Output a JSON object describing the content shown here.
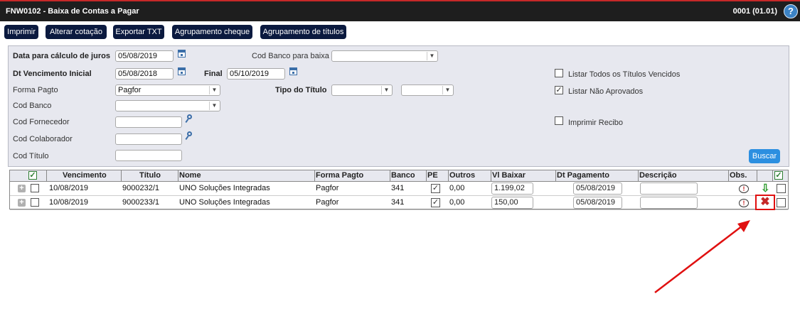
{
  "window": {
    "title": "FNW0102 - Baixa de Contas a Pagar",
    "version": "0001 (01.01)",
    "help_glyph": "?"
  },
  "toolbar": [
    "Imprimir",
    "Alterar cotação",
    "Exportar TXT",
    "Agrupamento cheque",
    "Agrupamento de títulos"
  ],
  "filters": {
    "data_juros": {
      "label": "Data para cálculo de juros",
      "value": "05/08/2019"
    },
    "cod_banco_baixa": {
      "label": "Cod Banco para baixa",
      "value": ""
    },
    "dt_venc_inicial": {
      "label": "Dt Vencimento Inicial",
      "value": "05/08/2018"
    },
    "final": {
      "label": "Final",
      "value": "05/10/2019"
    },
    "forma_pagto": {
      "label": "Forma Pagto",
      "value": "Pagfor"
    },
    "tipo_titulo": {
      "label": "Tipo do Título",
      "value1": "",
      "value2": ""
    },
    "cod_banco": {
      "label": "Cod Banco",
      "value": ""
    },
    "cod_fornecedor": {
      "label": "Cod Fornecedor",
      "value": ""
    },
    "cod_colaborador": {
      "label": "Cod Colaborador",
      "value": ""
    },
    "cod_titulo": {
      "label": "Cod Título",
      "value": ""
    },
    "listar_vencidos": {
      "label": "Listar Todos os Títulos Vencidos",
      "checked": false
    },
    "listar_nao_aprovados": {
      "label": "Listar Não Aprovados",
      "checked": true
    },
    "imprimir_recibo": {
      "label": "Imprimir Recibo",
      "checked": false
    },
    "buscar": "Buscar"
  },
  "grid": {
    "headers": {
      "vencimento": "Vencimento",
      "titulo": "Título",
      "nome": "Nome",
      "forma": "Forma Pagto",
      "banco": "Banco",
      "pe": "PE",
      "outros": "Outros",
      "vl_baixar": "Vl Baixar",
      "dt_pagamento": "Dt Pagamento",
      "descricao": "Descrição",
      "obs": "Obs."
    },
    "check_glyph": "✓",
    "plus_glyph": "+",
    "obs_glyph": "!",
    "down_glyph": "⇩",
    "x_glyph": "✖",
    "rows": [
      {
        "vencimento": "10/08/2019",
        "titulo": "9000232/1",
        "nome": "UNO Soluções Integradas",
        "forma": "Pagfor",
        "banco": "341",
        "pe": true,
        "outros": "0,00",
        "vl_baixar": "1.199,02",
        "dt_pagamento": "05/08/2019",
        "descricao": "",
        "action": "down-arrow-icon"
      },
      {
        "vencimento": "10/08/2019",
        "titulo": "9000233/1",
        "nome": "UNO Soluções Integradas",
        "forma": "Pagfor",
        "banco": "341",
        "pe": true,
        "outros": "0,00",
        "vl_baixar": "150,00",
        "dt_pagamento": "05/08/2019",
        "descricao": "",
        "action": "delete-x-icon"
      }
    ]
  },
  "colors": {
    "title_bar": "#1e1e1e",
    "button_bg": "#0b1a3f",
    "buscar_bg": "#2c8fe0",
    "highlight_red": "#e01010",
    "panel_bg": "#e7e8ef"
  }
}
